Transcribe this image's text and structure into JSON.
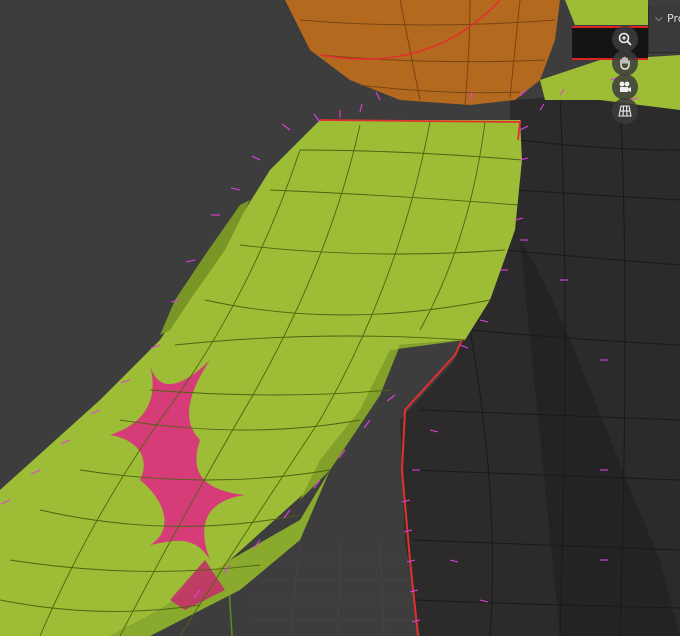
{
  "viewport": {
    "background_color": "#3d3d3d",
    "mesh_colors": {
      "sleeve_green": "#9cbd35",
      "sleeve_shadow": "#7a9626",
      "star_pink": "#d63c78",
      "body_dark": "#2c2a2b",
      "head_orange": "#b46a1e",
      "seam_red": "#e23030",
      "normal_magenta": "#e040e0"
    }
  },
  "navigation_gizmos": [
    {
      "name": "zoom-icon"
    },
    {
      "name": "hand-pan-icon"
    },
    {
      "name": "camera-view-icon"
    },
    {
      "name": "grid-ortho-icon"
    }
  ],
  "properties_panel": {
    "label": "Prop",
    "icon": "chevron-down-icon"
  }
}
